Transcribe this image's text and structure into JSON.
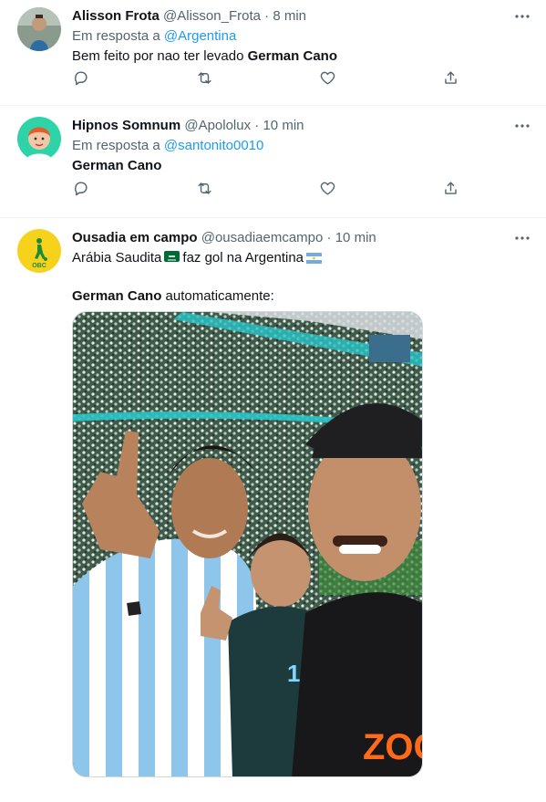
{
  "tweets": [
    {
      "author_name": "Alisson Frota",
      "handle": "@Alisson_Frota",
      "time": "8 min",
      "reply_prefix": "Em resposta a",
      "reply_to": "@Argentina",
      "text_before": "Bem feito por nao ter levado ",
      "text_bold": "German Cano"
    },
    {
      "author_name": "Hipnos Somnum",
      "handle": "@Apololux",
      "time": "10 min",
      "reply_prefix": "Em resposta a",
      "reply_to": "@santonito0010",
      "text_bold": "German Cano"
    },
    {
      "author_name": "Ousadia em campo",
      "handle": "@ousadiaemcampo",
      "time": "10 min",
      "line1_a": "Arábia Saudita",
      "line1_b": "faz gol na Argentina",
      "line2_bold": "German Cano",
      "line2_rest": " automaticamente:",
      "avatar_text": "OBC",
      "photo_jersey_number": "14",
      "photo_shirt_brand": "ZOO"
    }
  ],
  "separator": "·",
  "icons": [
    "more-icon",
    "reply-icon",
    "retweet-icon",
    "like-icon",
    "share-icon"
  ],
  "colors": {
    "link": "#1d9bf0",
    "muted": "#536471",
    "text": "#0f1419",
    "border": "#eff3f4"
  }
}
